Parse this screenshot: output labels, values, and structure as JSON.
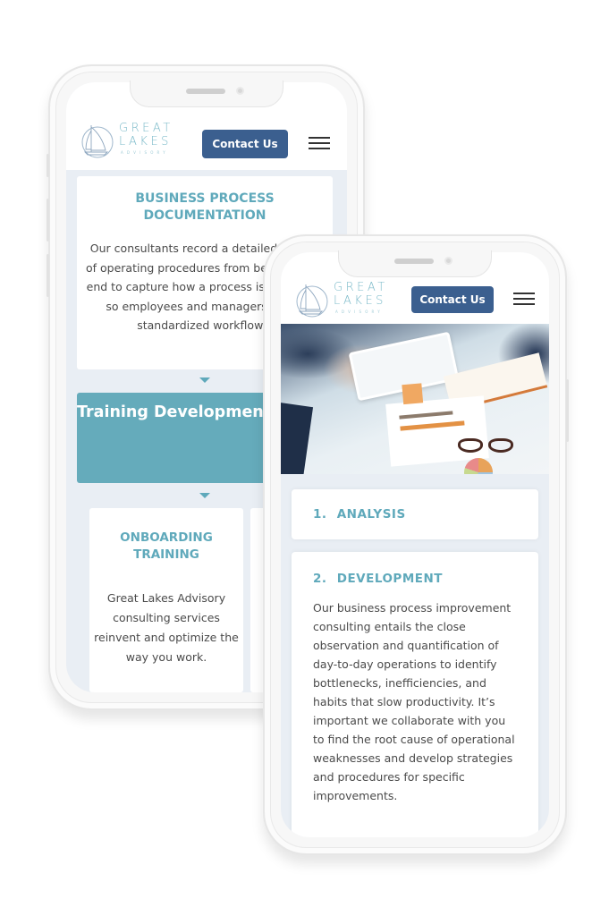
{
  "brand": {
    "name_line1": "GREAT",
    "name_line2": "LAKES",
    "tagline": "ADVISORY",
    "logo_icon": "sailboat-icon",
    "accent_color": "#5fa9bb",
    "button_color": "#3b5f8f"
  },
  "header": {
    "contact_label": "Contact Us",
    "menu_icon": "hamburger-menu-icon"
  },
  "phone_back": {
    "process_card": {
      "title": "BUSINESS PROCESS DOCUMENTATION",
      "body": "Our consultants record a detailed outline of operating procedures from beginning to end to capture how a process is executed, so employees and managers follow standardized workflows."
    },
    "section_banner": "Training Development Programs & Instructional Design",
    "training_card": {
      "title": "ONBOARDING TRAINING",
      "body": "Great Lakes Advisory consulting services reinvent and optimize the way you work."
    }
  },
  "phone_front": {
    "hero_image": "business-meeting-documents-photo",
    "steps": [
      {
        "number": "1.",
        "title": "ANALYSIS"
      },
      {
        "number": "2.",
        "title": "DEVELOPMENT",
        "body": "Our business process improvement consulting entails the close observation and quantification of day-to-day operations to identify bottlenecks, inefficiencies, and habits that slow productivity. It’s important we collaborate with you to find the root cause of operational weaknesses and develop strategies and procedures for specific improvements."
      }
    ]
  }
}
